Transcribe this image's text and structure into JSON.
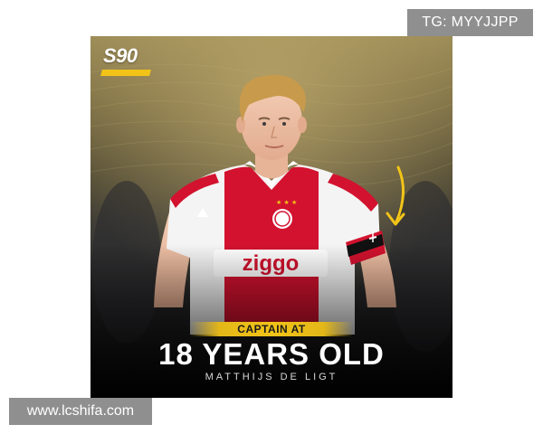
{
  "watermarks": {
    "top": "TG: MYYJJPP",
    "bottom": "www.lcshifa.com"
  },
  "poster": {
    "brand": "S90",
    "banner": "CAPTAIN AT",
    "headline": "18 YEARS OLD",
    "player_name": "MATTHIJS DE LIGT",
    "shirt_sponsor": "ziggo",
    "colors": {
      "accent_yellow": "#f2c418",
      "ajax_red": "#d2122e",
      "shirt_white": "#f4f4f4"
    },
    "icons": [
      "arrow-icon",
      "captain-armband"
    ]
  }
}
